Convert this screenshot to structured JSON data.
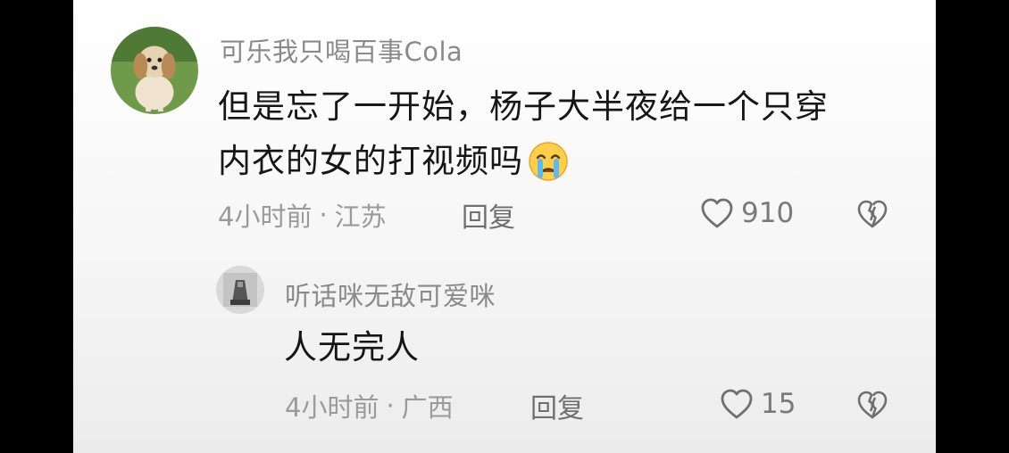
{
  "comment": {
    "username": "可乐我只喝百事Cola",
    "text_line1": "但是忘了一开始，杨子大半夜给一个只穿",
    "text_line2": "内衣的女的打视频吗",
    "emoji": "crying-emoji",
    "time": "4小时前",
    "separator": "·",
    "location": "江苏",
    "reply_label": "回复",
    "likes": "910"
  },
  "reply": {
    "username": "听话咪无敌可爱咪",
    "text": "人无完人",
    "time": "4小时前",
    "separator": "·",
    "location": "广西",
    "reply_label": "回复",
    "likes": "15"
  },
  "colors": {
    "background": "#000000",
    "panel": "#ffffff",
    "username": "#8a8a8a",
    "text": "#161616",
    "meta": "#9a9a9a"
  },
  "icons": {
    "like": "heart-outline-icon",
    "dislike": "broken-heart-icon"
  }
}
